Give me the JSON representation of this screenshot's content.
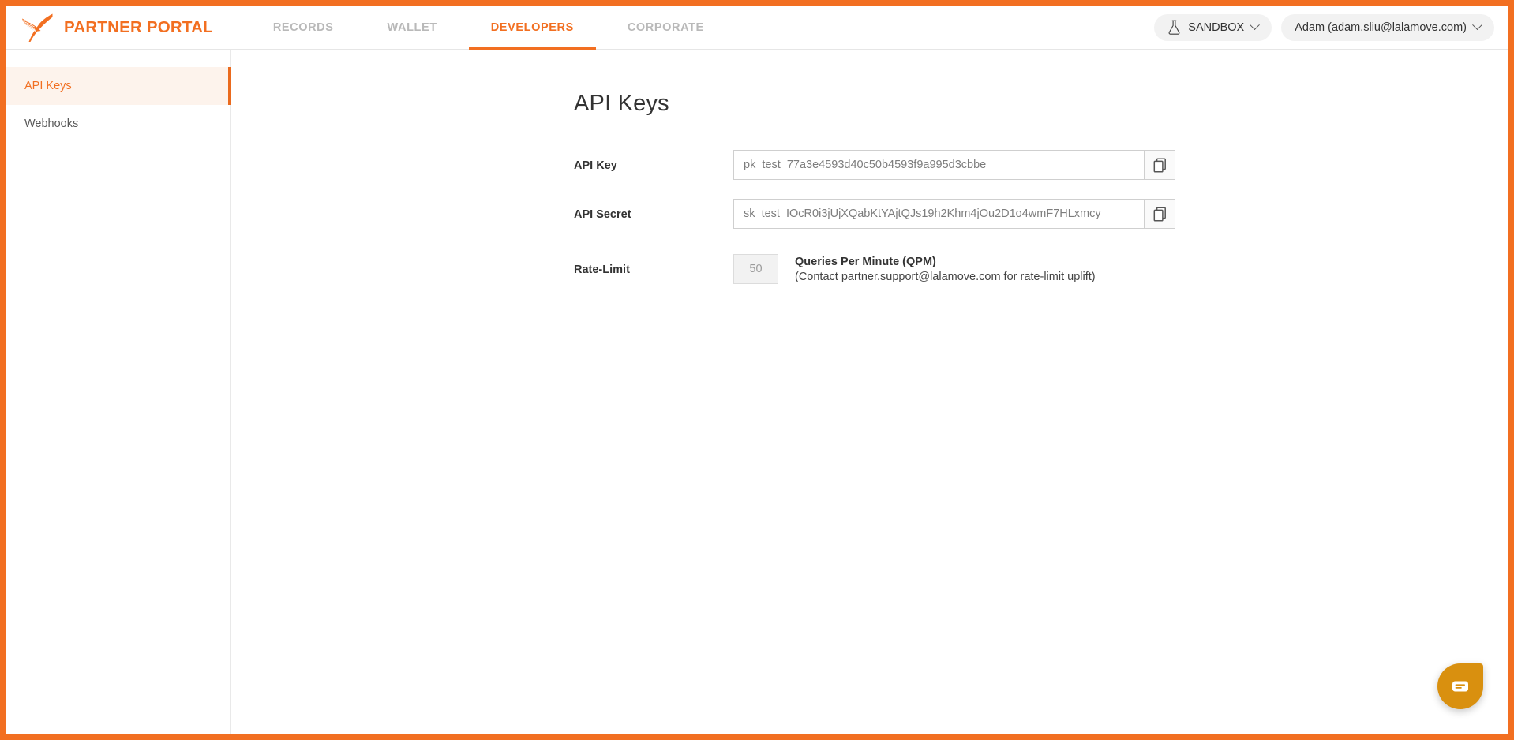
{
  "brand": {
    "title": "PARTNER PORTAL",
    "logo_icon": "hummingbird-logo",
    "accent_color": "#f26f21"
  },
  "header": {
    "tabs": [
      {
        "label": "RECORDS",
        "active": false
      },
      {
        "label": "WALLET",
        "active": false
      },
      {
        "label": "DEVELOPERS",
        "active": true
      },
      {
        "label": "CORPORATE",
        "active": false
      }
    ],
    "environment": {
      "label": "SANDBOX",
      "icon": "flask-icon",
      "chevron": "chevron-down-icon"
    },
    "account": {
      "label": "Adam (adam.sliu@lalamove.com)",
      "chevron": "chevron-down-icon"
    }
  },
  "sidebar": {
    "items": [
      {
        "label": "API Keys",
        "active": true
      },
      {
        "label": "Webhooks",
        "active": false
      }
    ]
  },
  "main": {
    "title": "API Keys",
    "fields": [
      {
        "label": "API Key",
        "value": "pk_test_77a3e4593d40c50b4593f9a995d3cbbe",
        "copy_icon": "copy-icon"
      },
      {
        "label": "API Secret",
        "value": "sk_test_IOcR0i3jUjXQabKtYAjtQJs19h2Khm4jOu2D1o4wmF7HLxmcy",
        "copy_icon": "copy-icon"
      }
    ],
    "rate_limit": {
      "label": "Rate-Limit",
      "value": "50",
      "title": "Queries Per Minute (QPM)",
      "note": "(Contact partner.support@lalamove.com for rate-limit uplift)"
    }
  },
  "chat": {
    "icon": "chat-bubble-icon",
    "color": "#d9900f"
  }
}
